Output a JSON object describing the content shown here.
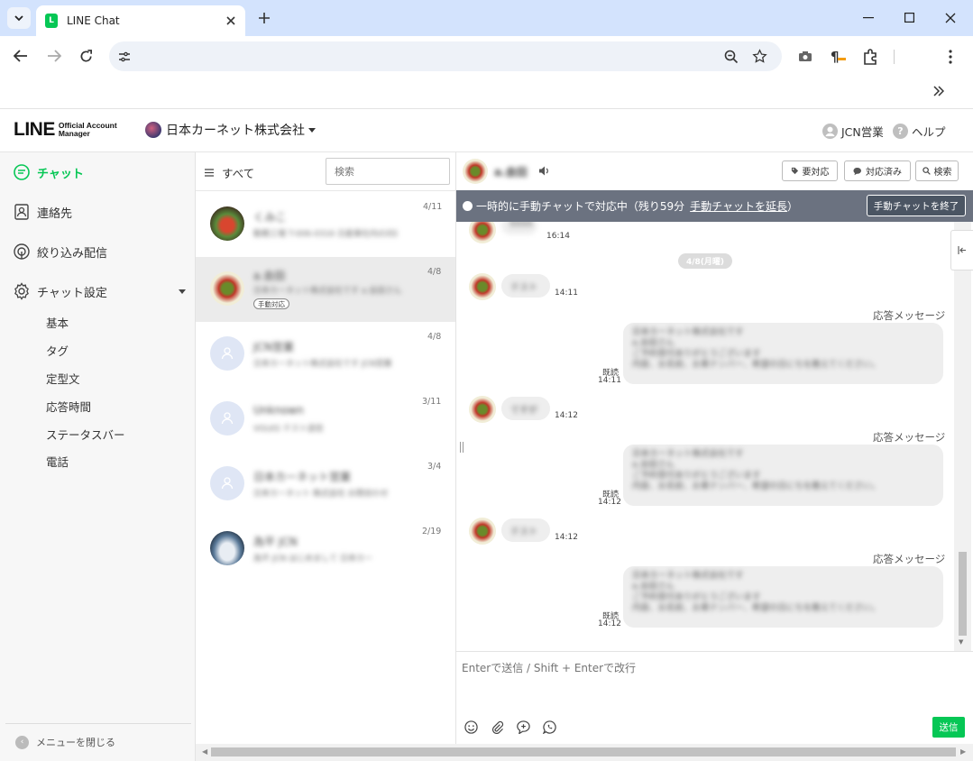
{
  "browser": {
    "tab_title": "LINE Chat"
  },
  "header": {
    "logo_main": "LINE",
    "logo_sub1": "Official Account",
    "logo_sub2": "Manager",
    "account": "日本カーネット株式会社",
    "user": "JCN営業",
    "help": "ヘルプ"
  },
  "sidebar": {
    "items": [
      {
        "label": "チャット"
      },
      {
        "label": "連絡先"
      },
      {
        "label": "絞り込み配信"
      },
      {
        "label": "チャット設定"
      }
    ],
    "sub_items": [
      "基本",
      "タグ",
      "定型文",
      "応答時間",
      "ステータスバー",
      "電話"
    ],
    "close_menu": "メニューを閉じる"
  },
  "list": {
    "filter": "すべて",
    "search_placeholder": "検索",
    "rows": [
      {
        "name": "くみこ",
        "preview": "勤務工場 T-006-0316 日産車社内の対応",
        "date": "4/11"
      },
      {
        "name": "a.会田",
        "preview": "日本カーネット株式会社です a.会田さん",
        "date": "4/8",
        "badge": "手動対応"
      },
      {
        "name": "JCN営業",
        "preview": "日本カーネット株式会社です JCN営業",
        "date": "4/8"
      },
      {
        "name": "Unknown",
        "preview": "VOLKS テスト送信",
        "date": "3/11"
      },
      {
        "name": "日本カーネット営業",
        "preview": "日本カーネット 株式会社 お問合わせ",
        "date": "3/4"
      },
      {
        "name": "為平 JCN",
        "preview": "為平 JCN はじめまして 日本カー",
        "date": "2/19"
      }
    ]
  },
  "chat": {
    "contact": "a.会田",
    "btn_todo": "要対応",
    "btn_done": "対応済み",
    "btn_search": "検索",
    "banner": {
      "text": "一時的に手動チャットで対応中（残り59分",
      "link": "手動チャットを延長",
      "close": "）",
      "end_button": "手動チャットを終了"
    },
    "date_sep": "4/8(月曜)",
    "first_msg": {
      "text": "5555",
      "time": "16:14"
    },
    "messages": [
      {
        "in_text": "テスト",
        "in_time": "14:11",
        "reply_label": "応答メッセージ",
        "reply_read": "既読",
        "reply_time": "14:11",
        "reply_lines": [
          "日本カーネット株式会社です",
          "a.会田さん",
          "ご予約受付ありがとうございます",
          "内容、お名前、お車ナンバー、希望の日にちを教えてください。"
        ]
      },
      {
        "in_text": "ですが",
        "in_time": "14:12",
        "reply_label": "応答メッセージ",
        "reply_read": "既読",
        "reply_time": "14:12",
        "reply_lines": [
          "日本カーネット株式会社です",
          "a.会田さん",
          "ご予約受付ありがとうございます",
          "内容、お名前、お車ナンバー、希望の日にちを教えてください。"
        ]
      },
      {
        "in_text": "テスト",
        "in_time": "14:12",
        "reply_label": "応答メッセージ",
        "reply_read": "既読",
        "reply_time": "14:12",
        "reply_lines": [
          "日本カーネット株式会社です",
          "a.会田さん",
          "ご予約受付ありがとうございます",
          "内容、お名前、お車ナンバー、希望の日にちを教えてください。"
        ]
      }
    ],
    "input_placeholder": "Enterで送信 / Shift + Enterで改行",
    "send": "送信"
  },
  "colors": {
    "accent": "#06c755",
    "banner": "#6b7280"
  }
}
